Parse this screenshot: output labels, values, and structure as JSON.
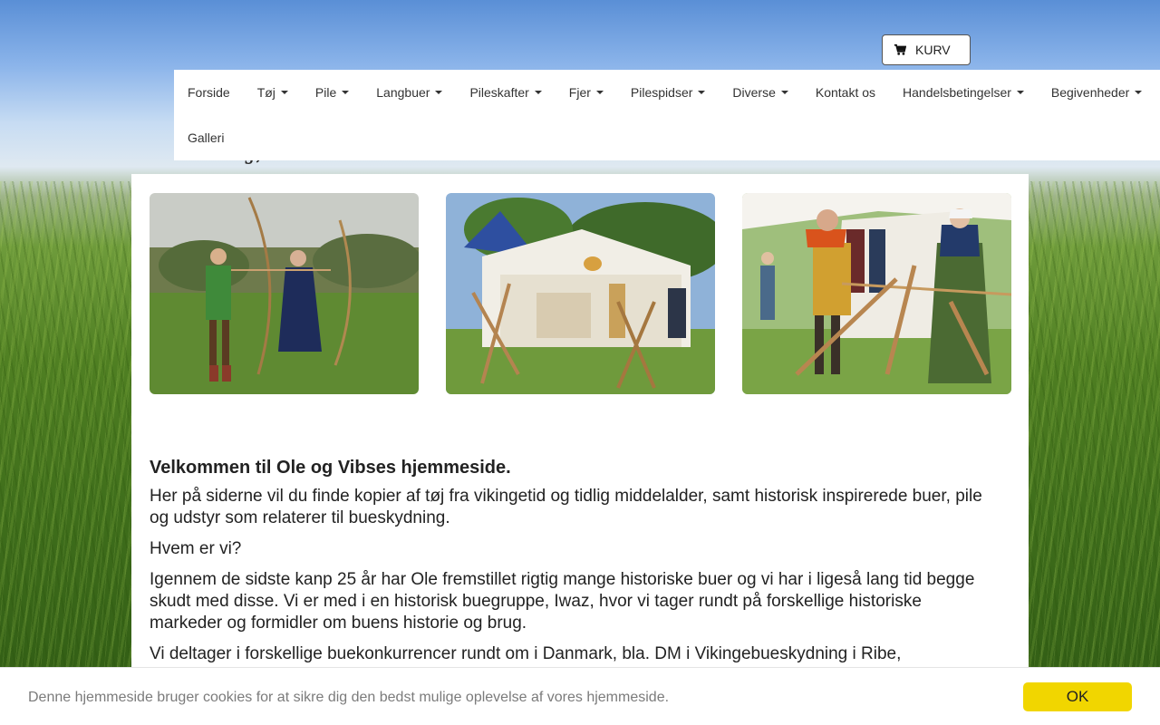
{
  "header": {
    "cart_label": "KURV",
    "tagline": "TØJ, BUER OG PILE FRA VIKINGETID OG MIDDELALDER"
  },
  "nav": {
    "row1": [
      {
        "label": "Forside",
        "dropdown": false
      },
      {
        "label": "Tøj",
        "dropdown": true
      },
      {
        "label": "Pile",
        "dropdown": true
      },
      {
        "label": "Langbuer",
        "dropdown": true
      },
      {
        "label": "Pileskafter",
        "dropdown": true
      },
      {
        "label": "Fjer",
        "dropdown": true
      },
      {
        "label": "Pilespidser",
        "dropdown": true
      },
      {
        "label": "Diverse",
        "dropdown": true
      },
      {
        "label": "Kontakt os",
        "dropdown": false
      },
      {
        "label": "Handelsbetingelser",
        "dropdown": true
      },
      {
        "label": "Begivenheder",
        "dropdown": true
      }
    ],
    "row2": [
      {
        "label": "Galleri",
        "dropdown": false
      }
    ]
  },
  "gallery": {
    "photos": [
      "archers-photo",
      "tent-camp-photo",
      "bow-making-photo"
    ]
  },
  "main": {
    "welcome": "Velkommen til Ole og Vibses hjemmeside.",
    "paragraphs": [
      "Her på siderne vil du finde kopier af tøj fra vikingetid og tidlig middelalder, samt historisk inspirerede buer, pile og udstyr som relaterer til bueskydning.",
      "Hvem er vi?",
      "Igennem de sidste kanp 25  år har Ole fremstillet rigtig mange historiske buer og vi har i ligeså lang tid begge skudt med disse. Vi er med i en historisk buegruppe, Iwaz, hvor vi  tager rundt på forskellige historiske markeder og formidler om buens historie og brug.",
      "Vi deltager i forskellige buekonkurrencer rundt om i Danmark, bla. DM i Vikingebueskydning i Ribe,"
    ]
  },
  "cookie": {
    "text": "Denne hjemmeside bruger cookies for at sikre dig den bedst mulige oplevelse af vores hjemmeside.",
    "ok_label": "OK"
  },
  "colors": {
    "cookie_button": "#f1d600",
    "nav_background": "#ffffff"
  }
}
